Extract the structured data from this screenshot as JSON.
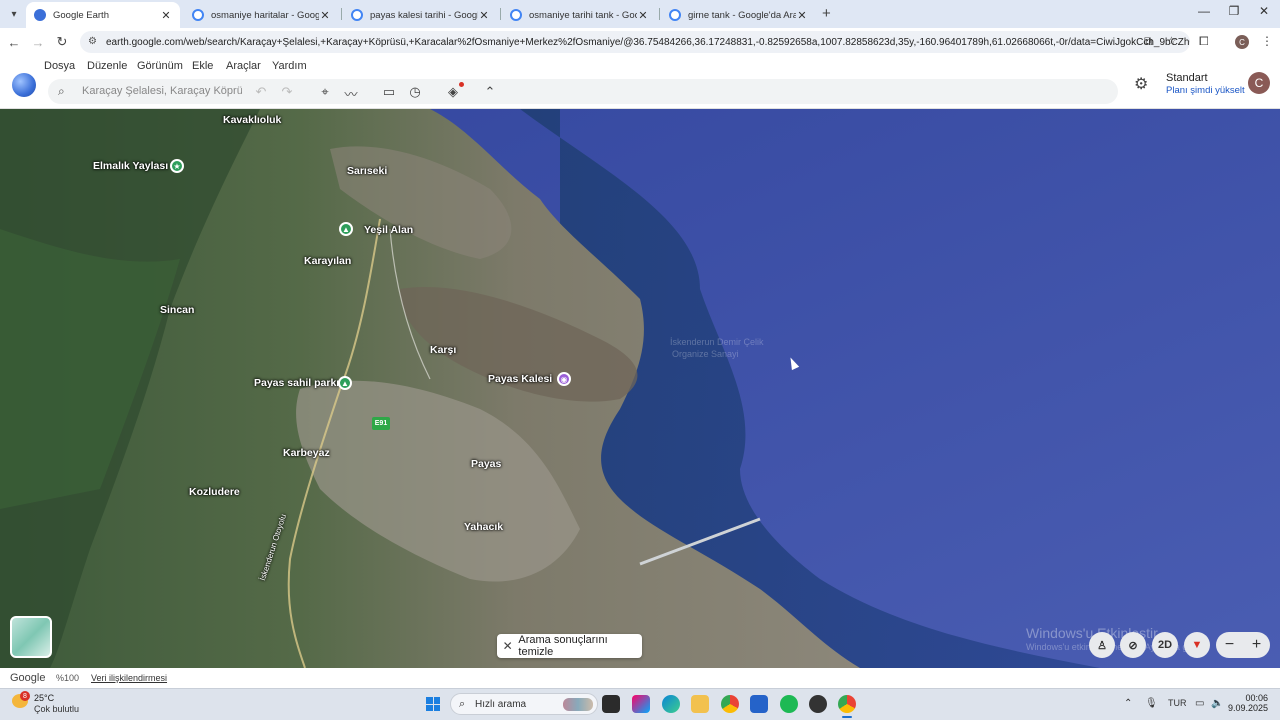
{
  "browser": {
    "tabs": [
      {
        "label": "Google Earth",
        "active": true
      },
      {
        "label": "osmaniye haritalar - Google'da A",
        "active": false
      },
      {
        "label": "payas kalesi tarihi - Google'da A",
        "active": false
      },
      {
        "label": "osmaniye tarihi tank - Google'da",
        "active": false
      },
      {
        "label": "girne tank - Google'da Ara",
        "active": false
      }
    ],
    "new_tab": "+",
    "url": "earth.google.com/web/search/Karaçay+Şelalesi,+Karaçay+Köprüsü,+Karacalar%2fOsmaniye+Merkez%2fOsmaniye/@36.75484266,36.17248831,-0.82592658a,1007.82858623d,35y,-160.96401789h,61.02668066t,-0r/data=CiwiJgokCch_9bCZh0JAEUaZ...",
    "profile_initial": "C",
    "window": {
      "minimize": "—",
      "restore": "❐",
      "close": "✕"
    }
  },
  "app": {
    "menu": [
      "Dosya",
      "Düzenle",
      "Görünüm",
      "Ekle",
      "Araçlar",
      "Yardım"
    ],
    "search_placeholder": "Karaçay Şelalesi, Karaçay Köprüsü",
    "plan_title": "Standart",
    "plan_link": "Planı şimdi yükselt",
    "profile_initial": "C"
  },
  "map": {
    "places": [
      {
        "name": "Kavaklıoluk",
        "bold": true
      },
      {
        "name": "Elmalık Yaylası",
        "bold": true
      },
      {
        "name": "Sarıseki",
        "bold": true
      },
      {
        "name": "Yeşil Alan",
        "bold": true
      },
      {
        "name": "Karayılan",
        "bold": true
      },
      {
        "name": "Sincan",
        "bold": true
      },
      {
        "name": "Karşı",
        "bold": true
      },
      {
        "name": "Payas Kalesi",
        "bold": true
      },
      {
        "name": "Payas sahil parkı",
        "bold": true
      },
      {
        "name": "Karbeyaz",
        "bold": true
      },
      {
        "name": "Payas",
        "bold": true
      },
      {
        "name": "Kozludere",
        "bold": true
      },
      {
        "name": "Yahacık",
        "bold": true
      },
      {
        "name": "İskenderun Otoyolu",
        "bold": false
      }
    ],
    "road_badge": "E91",
    "ghost_labels": [
      "İskenderun Demir Çelik",
      "Organize Sanayi"
    ],
    "clear_results": "Arama sonuçlarını temizle",
    "controls": {
      "mode_2d": "2D",
      "zoom_out": "−",
      "zoom_in": "+"
    },
    "watermark": "Windows'u Etkinleştir",
    "watermark_sub": "Windows'u etkinleştirmek için Ayarlar'a gidin."
  },
  "status": {
    "brand": "Google",
    "zoom": "%100",
    "credits": "Veri ilişkilendirmesi"
  },
  "taskbar": {
    "weather_badge": "8",
    "temp": "25°C",
    "condition": "Çok bulutlu",
    "search_label": "Hızlı arama",
    "lang": "TUR",
    "time": "00:06",
    "date": "9.09.2025"
  },
  "colors": {
    "sea": "#3c51a6",
    "accent_link": "#1a56c6",
    "tabbar": "#dfe7f4"
  }
}
